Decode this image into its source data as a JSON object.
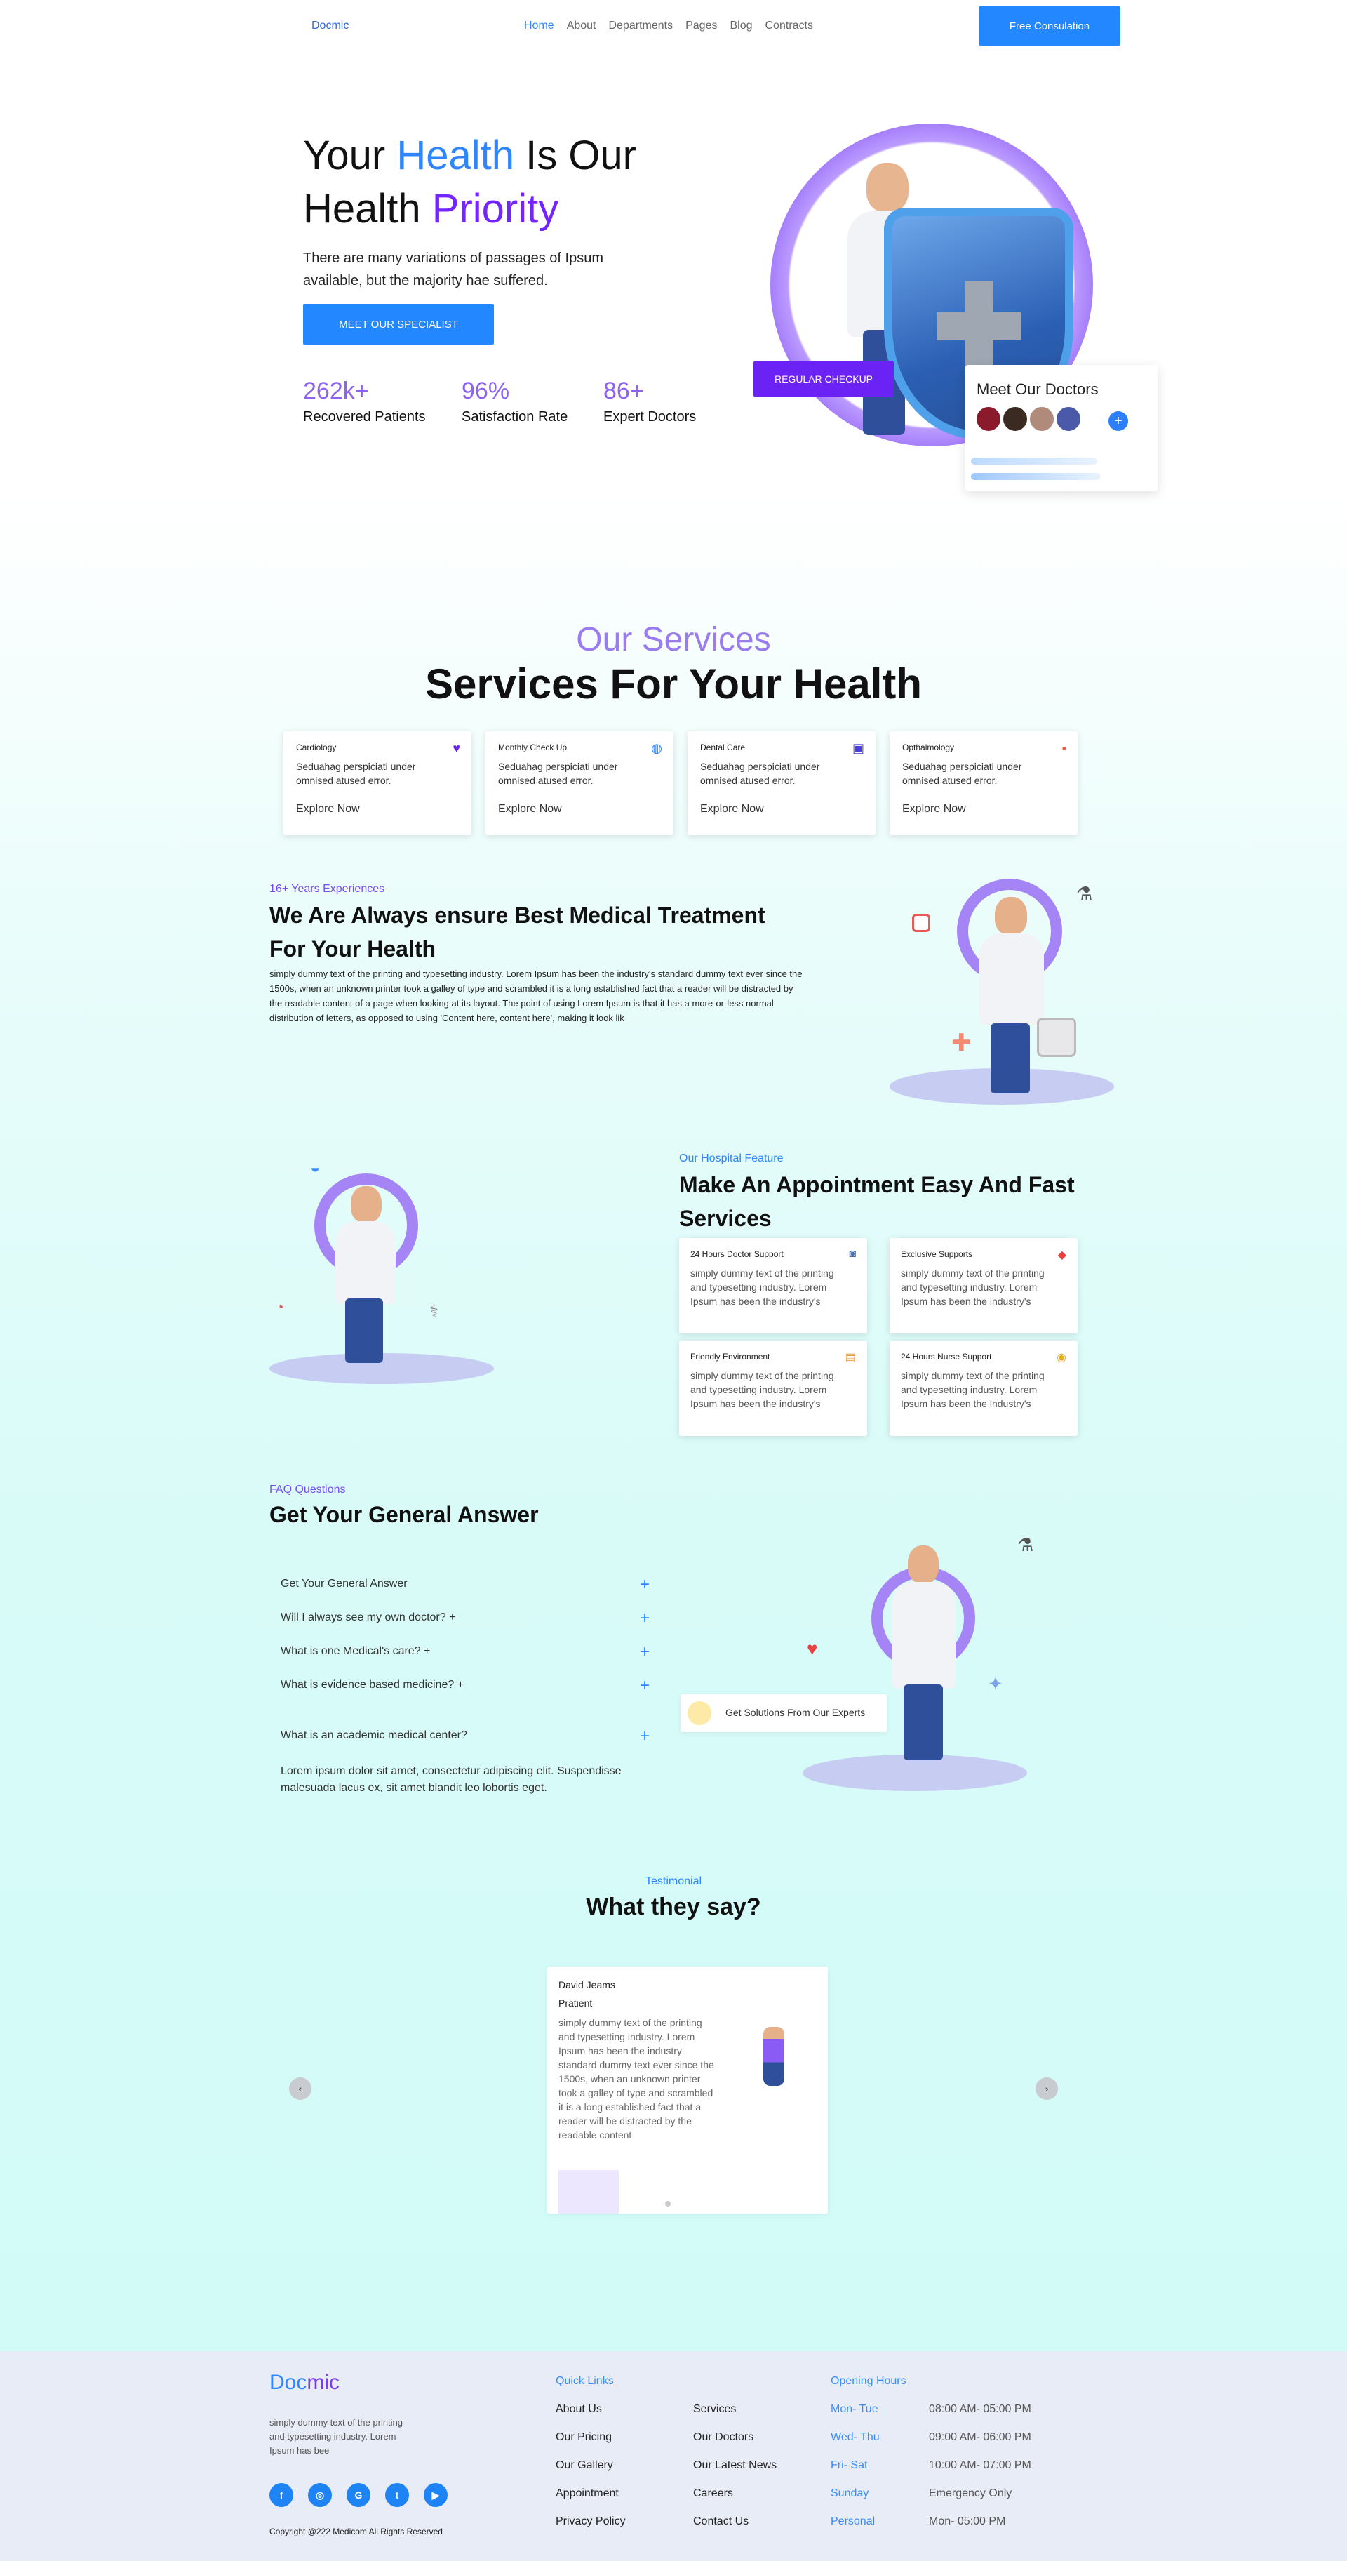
{
  "nav": {
    "logo": "Docmic",
    "links": [
      "Home",
      "About",
      "Departments",
      "Pages",
      "Blog",
      "Contracts"
    ],
    "cta": "Free Consulation"
  },
  "hero": {
    "title_1": "Your ",
    "title_highlight_1": "Health",
    "title_2": " Is Our",
    "title_3": "Health ",
    "title_highlight_2": "Priority",
    "description": "There are many variations of passages of Ipsum available, but the majority hae suffered.",
    "cta": "MEET OUR SPECIALIST",
    "stats": [
      {
        "value": "262k+",
        "label": "Recovered Patients"
      },
      {
        "value": "96%",
        "label": "Satisfaction Rate"
      },
      {
        "value": "86+",
        "label": "Expert Doctors"
      }
    ],
    "checkup_button": "REGULAR CHECKUP",
    "doctors_card_title": "Meet Our Doctors"
  },
  "services": {
    "kicker": "Our Services",
    "title": "Services For Your Health",
    "cards": [
      {
        "name": "Cardiology",
        "desc": "Seduahag perspiciati under omnised atused error.",
        "link": "Explore Now",
        "icon": "heart-icon"
      },
      {
        "name": "Monthly Check Up",
        "desc": "Seduahag perspiciati under omnised atused error.",
        "link": "Explore Now",
        "icon": "tooth-icon"
      },
      {
        "name": "Dental Care",
        "desc": "Seduahag perspiciati under omnised atused error.",
        "link": "Explore Now",
        "icon": "clipboard-icon"
      },
      {
        "name": "Opthalmology",
        "desc": "Seduahag perspiciati under omnised atused error.",
        "link": "Explore Now",
        "icon": "medkit-icon"
      }
    ]
  },
  "about": {
    "kicker": "16+ Years Experiences",
    "title": "We Are Always ensure Best Medical Treatment For Your Health",
    "description": "simply dummy text of the printing and typesetting industry. Lorem Ipsum has been the industry's standard dummy text ever since the 1500s, when an unknown printer took a galley of type and scrambled it is a long established fact that a reader will be distracted by the readable content of a page when looking at its layout. The point of using Lorem Ipsum is that it has a more-or-less normal distribution of letters, as opposed to using 'Content here, content here', making it look lik"
  },
  "appointment": {
    "kicker": "Our Hospital Feature",
    "title": "Make An Appointment Easy And Fast Services",
    "features": [
      {
        "name": "24 Hours Doctor Support",
        "desc": "simply dummy text of the printing and typesetting industry. Lorem Ipsum has been the industry's"
      },
      {
        "name": "Exclusive Supports",
        "desc": "simply dummy text of the printing and typesetting industry. Lorem Ipsum has been the industry's"
      },
      {
        "name": "Friendly Environment",
        "desc": "simply dummy text of the printing and typesetting industry. Lorem Ipsum has been the industry's"
      },
      {
        "name": "24 Hours Nurse Support",
        "desc": "simply dummy text of the printing and typesetting industry. Lorem Ipsum has been the industry's"
      }
    ]
  },
  "faq": {
    "kicker": "FAQ Questions",
    "title": "Get Your General Answer",
    "items": [
      "Get Your General Answer",
      "Will I always see my own doctor? +",
      "What is one Medical's care? +",
      "What is evidence based medicine? +",
      "What is an academic medical center?"
    ],
    "answer": "Lorem ipsum dolor sit amet, consectetur adipiscing elit. Suspendisse malesuada lacus ex, sit amet blandit leo lobortis eget.",
    "solutions_label": "Get Solutions From Our Experts"
  },
  "testimonial": {
    "kicker": "Testimonial",
    "title": "What they say?",
    "name": "David Jeams",
    "role": "Pratient",
    "quote": "simply dummy text of the printing and typesetting industry. Lorem Ipsum has been the industry standard dummy text ever since the 1500s, when an unknown printer took a galley of type and scrambled it is a long established fact that a reader will be distracted by the readable content",
    "prev": "‹",
    "next": "›"
  },
  "footer": {
    "logo_a": "Doc",
    "logo_b": "mic",
    "description": "simply dummy text of the printing and typesetting industry. Lorem Ipsum has bee",
    "social": [
      "f",
      "◎",
      "G",
      "t",
      "▶"
    ],
    "copyright": "Copyright @222 Medicom All Rights Reserved",
    "quick_links_title": "Quick Links",
    "links_col1": [
      "About Us",
      "Our Pricing",
      "Our Gallery",
      "Appointment",
      "Privacy Policy"
    ],
    "links_col2": [
      "Services",
      "Our Doctors",
      "Our Latest News",
      "Careers",
      "Contact Us"
    ],
    "hours_title": "Opening Hours",
    "hours": [
      {
        "day": "Mon- Tue",
        "time": "08:00 AM- 05:00 PM"
      },
      {
        "day": "Wed- Thu",
        "time": "09:00 AM- 06:00 PM"
      },
      {
        "day": "Fri- Sat",
        "time": "10:00 AM- 07:00 PM"
      },
      {
        "day": "Sunday",
        "time": "Emergency Only"
      },
      {
        "day": "Personal",
        "time": "Mon- 05:00 PM"
      }
    ]
  }
}
